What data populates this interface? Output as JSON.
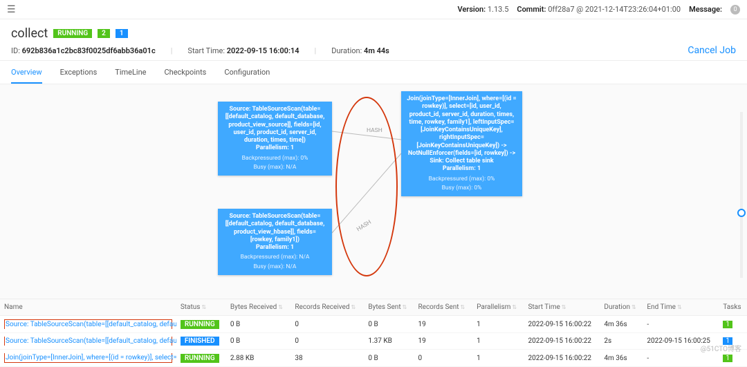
{
  "topbar": {
    "version_label": "Version:",
    "version": "1.13.5",
    "commit_label": "Commit:",
    "commit": "0ff28a7 @ 2021-12-14T23:26:04+01:00",
    "message_label": "Message:",
    "message_count": "0"
  },
  "job": {
    "title": "collect",
    "status": "RUNNING",
    "badge_green": "2",
    "badge_blue": "1",
    "id_label": "ID:",
    "id": "692b836a1c2bc83f0025df6abb36a01c",
    "start_label": "Start Time:",
    "start": "2022-09-15 16:00:14",
    "duration_label": "Duration:",
    "duration": "4m 44s",
    "cancel": "Cancel Job"
  },
  "tabs": {
    "overview": "Overview",
    "exceptions": "Exceptions",
    "timeline": "TimeLine",
    "checkpoints": "Checkpoints",
    "configuration": "Configuration"
  },
  "graph": {
    "node1_title": "Source: TableSourceScan(table=[[default_catalog, default_database, product_view_source]], fields=[id, user_id, product_id, server_id, duration, times, time])",
    "node1_par": "Parallelism: 1",
    "node1_bp": "Backpressured (max): 0%",
    "node1_busy": "Busy (max): N/A",
    "node2_title": "Source: TableSourceScan(table=[[default_catalog, default_database, product_view_hbase]], fields=[rowkey, family1])",
    "node2_par": "Parallelism: 1",
    "node2_bp": "Backpressured (max): N/A",
    "node2_busy": "Busy (max): N/A",
    "node3_title": "Join(joinType=[InnerJoin], where=[(id = rowkey)], select=[id, user_id, product_id, server_id, duration, times, time, rowkey, family1], leftInputSpec=[JoinKeyContainsUniqueKey], rightInputSpec=[JoinKeyContainsUniqueKey]) -> NotNullEnforcer(fields=[id, rowkey]) -> Sink: Collect table sink",
    "node3_par": "Parallelism: 1",
    "node3_bp": "Backpressured (max): 0%",
    "node3_busy": "Busy (max): 0%",
    "edge1": "HASH",
    "edge2": "HASH"
  },
  "table": {
    "headers": {
      "name": "Name",
      "status": "Status",
      "bytes_recv": "Bytes Received",
      "records_recv": "Records Received",
      "bytes_sent": "Bytes Sent",
      "records_sent": "Records Sent",
      "parallelism": "Parallelism",
      "start": "Start Time",
      "duration": "Duration",
      "end": "End Time",
      "tasks": "Tasks"
    },
    "rows": [
      {
        "name": "Source: TableSourceScan(table=[[default_catalog, default_database, pro…",
        "status": "RUNNING",
        "bytes_recv": "0 B",
        "records_recv": "0",
        "bytes_sent": "0 B",
        "records_sent": "19",
        "parallelism": "1",
        "start": "2022-09-15 16:00:22",
        "duration": "4m 36s",
        "end": "-",
        "tasks": "1",
        "task_class": "green"
      },
      {
        "name": "Source: TableSourceScan(table=[[default_catalog, default_database, pro…",
        "status": "FINISHED",
        "bytes_recv": "0 B",
        "records_recv": "0",
        "bytes_sent": "1.37 KB",
        "records_sent": "19",
        "parallelism": "1",
        "start": "2022-09-15 16:00:22",
        "duration": "2s",
        "end": "2022-09-15 16:00:25",
        "tasks": "1",
        "task_class": "blue"
      },
      {
        "name": "Join(joinType=[InnerJoin], where=[(id = rowkey)], select=[id, user_id, p…",
        "status": "RUNNING",
        "bytes_recv": "2.88 KB",
        "records_recv": "38",
        "bytes_sent": "0 B",
        "records_sent": "0",
        "parallelism": "1",
        "start": "2022-09-15 16:00:22",
        "duration": "4m 36s",
        "end": "-",
        "tasks": "1",
        "task_class": "green"
      }
    ]
  },
  "watermark": "@51CTO博客"
}
